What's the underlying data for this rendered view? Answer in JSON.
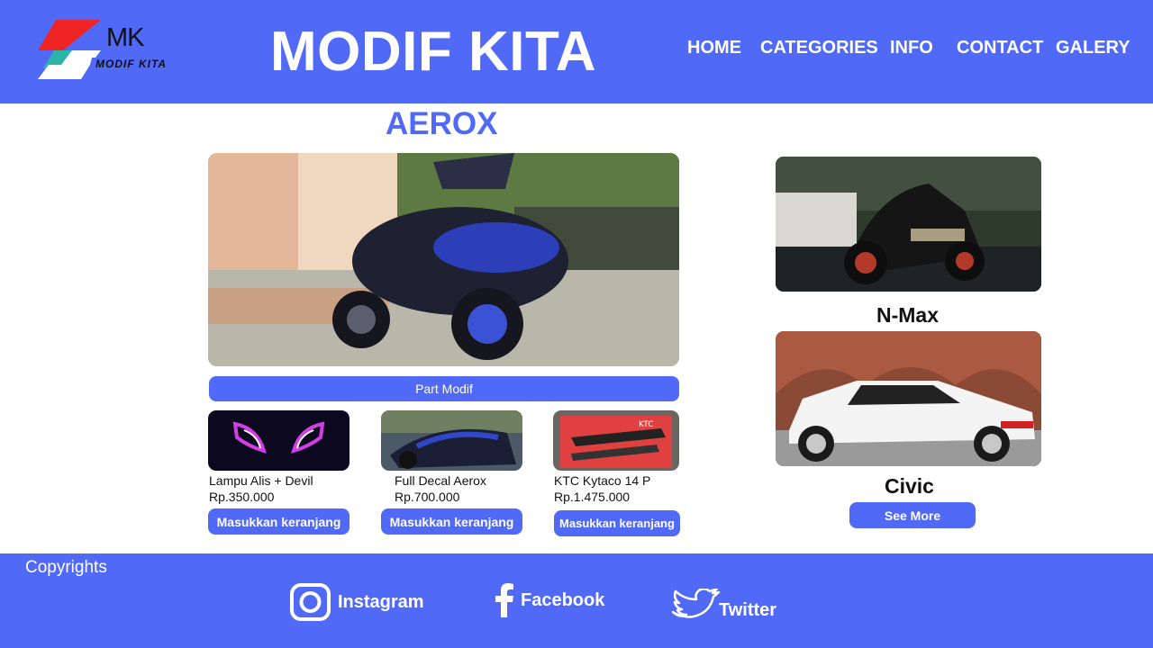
{
  "header": {
    "logo_initials": "MK",
    "logo_text": "MODIF KITA",
    "title": "MODIF KITA",
    "nav": [
      "HOME",
      "CATEGORIES",
      "INFO",
      "CONTACT",
      "GALERY"
    ]
  },
  "main": {
    "section_title": "AEROX",
    "part_button": "Part Modif",
    "products": [
      {
        "name": "Lampu Alis + Devil",
        "price": "Rp.350.000",
        "button": "Masukkan keranjang"
      },
      {
        "name": "Full Decal Aerox",
        "price": "Rp.700.000",
        "button": "Masukkan keranjang"
      },
      {
        "name": "KTC Kytaco 14 P",
        "price": "Rp.1.475.000",
        "button": "Masukkan keranjang"
      }
    ]
  },
  "sidebar": {
    "items": [
      {
        "label": "N-Max"
      },
      {
        "label": "Civic"
      }
    ],
    "see_more": "See More"
  },
  "footer": {
    "copyright": "Copyrights",
    "social": [
      {
        "label": "Instagram",
        "icon": "instagram-icon"
      },
      {
        "label": "Facebook",
        "icon": "facebook-icon"
      },
      {
        "label": "Twitter",
        "icon": "twitter-icon"
      }
    ]
  },
  "colors": {
    "primary": "#5069f7",
    "white": "#ffffff",
    "logo_red": "#ef2525",
    "logo_teal": "#2bb5a8"
  }
}
